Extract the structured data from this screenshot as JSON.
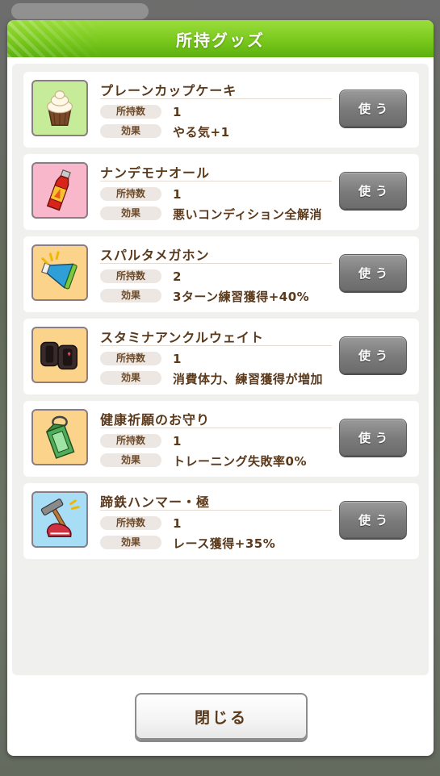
{
  "dialog": {
    "title": "所持グッズ",
    "close_label": "閉じる",
    "quantity_label": "所持数",
    "effect_label": "効果",
    "use_label": "使う"
  },
  "items": [
    {
      "name": "プレーンカップケーキ",
      "quantity": "1",
      "effect": "やる気+1",
      "icon": "cupcake-icon",
      "bg": "#c6ec9a"
    },
    {
      "name": "ナンデモナオール",
      "quantity": "1",
      "effect": "悪いコンディション全解消",
      "icon": "drink-bottle-icon",
      "bg": "#f9b7cb"
    },
    {
      "name": "スパルタメガホン",
      "quantity": "2",
      "effect": "3ターン練習獲得+40%",
      "icon": "megaphone-icon",
      "bg": "#fbd38b"
    },
    {
      "name": "スタミナアンクルウェイト",
      "quantity": "1",
      "effect": "消費体力、練習獲得が増加",
      "icon": "ankle-weight-icon",
      "bg": "#fbd38b"
    },
    {
      "name": "健康祈願のお守り",
      "quantity": "1",
      "effect": "トレーニング失敗率0%",
      "icon": "amulet-icon",
      "bg": "#fbd38b"
    },
    {
      "name": "蹄鉄ハンマー・極",
      "quantity": "1",
      "effect": "レース獲得+35%",
      "icon": "hammer-horseshoe-icon",
      "bg": "#a8def5"
    }
  ]
}
